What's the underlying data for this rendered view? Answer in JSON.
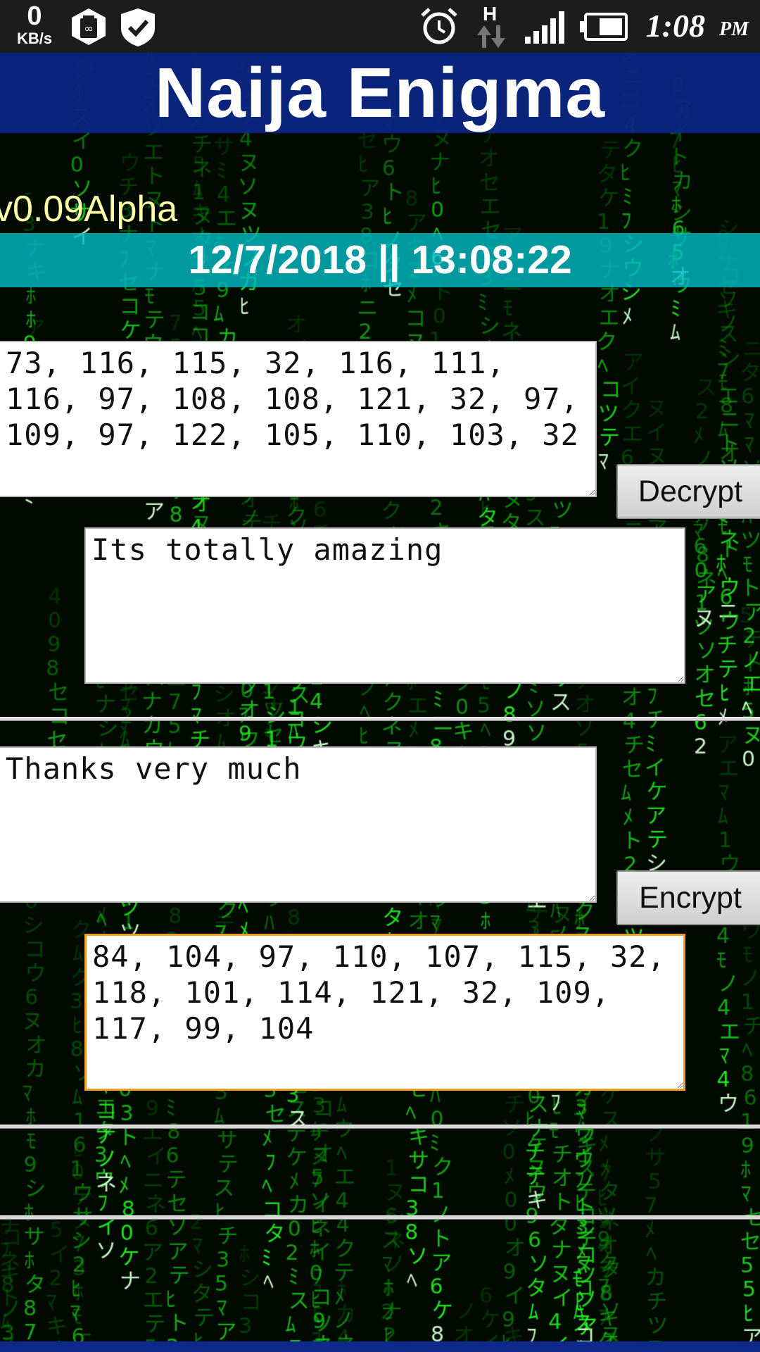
{
  "status_bar": {
    "net_speed_value": "0",
    "net_speed_unit": "KB/s",
    "left_icons": [
      "battery-saver-icon",
      "security-check-icon"
    ],
    "right_icons": [
      "alarm-icon",
      "network-h-icon",
      "signal-icon",
      "battery-icon"
    ],
    "network_type": "H",
    "time": "1:08",
    "ampm": "PM"
  },
  "app": {
    "title": "Naija Enigma",
    "version": "v0.09Alpha",
    "datetime": "12/7/2018 || 13:08:22"
  },
  "decrypt": {
    "input_value": "73, 116, 115, 32, 116, 111, 116, 97, 108, 108, 121, 32, 97, 109, 97, 122, 105, 110, 103, 32",
    "button_label": "Decrypt",
    "output_value": "Its totally amazing"
  },
  "encrypt": {
    "input_value": "Thanks very much",
    "button_label": "Encrypt",
    "output_value": "84, 104, 97, 110, 107, 115, 32, 118, 101, 114, 121, 32, 109, 117, 99, 104"
  },
  "colors": {
    "header_bg": "#0c288c",
    "date_bar_bg": "#00b9c3",
    "version_text": "#ffffa8",
    "matrix_green": "#2bd12b",
    "focus_border": "#f0a020"
  }
}
